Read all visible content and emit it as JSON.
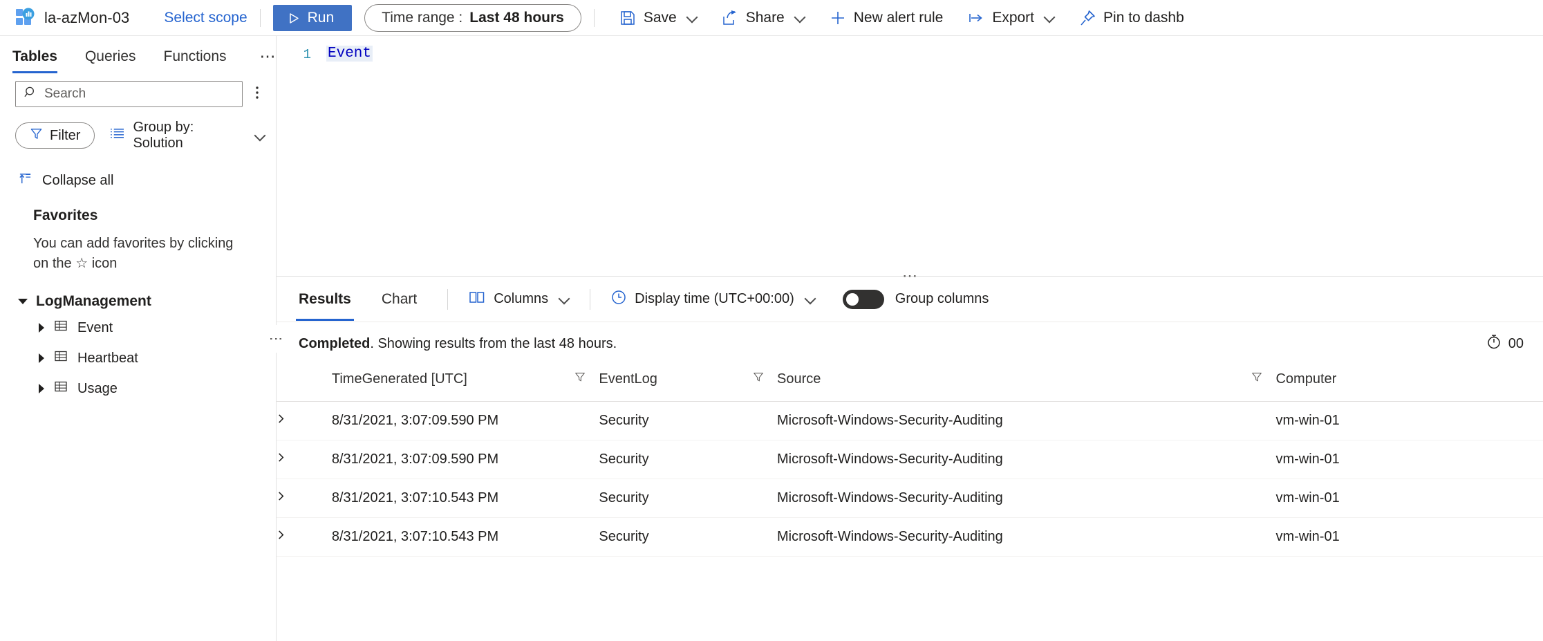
{
  "workspace": {
    "name": "la-azMon-03",
    "select_scope_label": "Select scope",
    "logo_icon": "log-analytics-workspace-icon"
  },
  "toolbar": {
    "run_label": "Run",
    "time_range_label": "Time range :",
    "time_range_value": "Last 48 hours",
    "save_label": "Save",
    "share_label": "Share",
    "new_alert_rule_label": "New alert rule",
    "export_label": "Export",
    "pin_label": "Pin to dashb",
    "icons": {
      "run": "play-icon",
      "save": "save-icon",
      "share": "share-icon",
      "new_alert": "plus-icon",
      "export": "export-icon",
      "pin": "pin-icon",
      "dropdown": "chevron-down-icon"
    }
  },
  "sidebar": {
    "tabs": [
      {
        "label": "Tables",
        "active": true
      },
      {
        "label": "Queries",
        "active": false
      },
      {
        "label": "Functions",
        "active": false
      }
    ],
    "more_label": "⋯",
    "collapse_panel_label": "«",
    "search": {
      "placeholder": "Search",
      "value": "",
      "icon": "search-icon",
      "menu_icon": "vertical-dots-icon"
    },
    "filter_label": "Filter",
    "filter_icon": "funnel-icon",
    "group_by_label": "Group by: Solution",
    "group_by_icon": "group-list-icon",
    "collapse_all_label": "Collapse all",
    "collapse_all_icon": "collapse-all-icon",
    "favorites": {
      "heading": "Favorites",
      "empty_text_1": "You can add favorites by clicking on",
      "empty_text_2_pre": "the",
      "empty_text_star": "☆",
      "empty_text_2_post": "icon"
    },
    "tree": [
      {
        "group": "LogManagement",
        "expanded": true,
        "items": [
          {
            "label": "Event",
            "icon": "table-icon"
          },
          {
            "label": "Heartbeat",
            "icon": "table-icon"
          },
          {
            "label": "Usage",
            "icon": "table-icon"
          }
        ]
      }
    ]
  },
  "editor": {
    "line_number": "1",
    "query_text": "Event"
  },
  "results": {
    "tabs": [
      {
        "label": "Results",
        "active": true
      },
      {
        "label": "Chart",
        "active": false
      }
    ],
    "columns_label": "Columns",
    "columns_icon": "columns-icon",
    "display_time_label": "Display time (UTC+00:00)",
    "display_time_icon": "clock-icon",
    "group_columns_label": "Group columns",
    "group_columns_on": false,
    "status_bold": "Completed",
    "status_rest": ". Showing results from the last 48 hours.",
    "elapsed_icon": "timer-icon",
    "elapsed_value": "00",
    "table": {
      "headers": [
        {
          "label": "TimeGenerated [UTC]",
          "filterable": true
        },
        {
          "label": "EventLog",
          "filterable": true
        },
        {
          "label": "Source",
          "filterable": true
        },
        {
          "label": "Computer",
          "filterable": false
        }
      ],
      "rows": [
        {
          "TimeGenerated": "8/31/2021, 3:07:09.590 PM",
          "EventLog": "Security",
          "Source": "Microsoft-Windows-Security-Auditing",
          "Computer": "vm-win-01"
        },
        {
          "TimeGenerated": "8/31/2021, 3:07:09.590 PM",
          "EventLog": "Security",
          "Source": "Microsoft-Windows-Security-Auditing",
          "Computer": "vm-win-01"
        },
        {
          "TimeGenerated": "8/31/2021, 3:07:10.543 PM",
          "EventLog": "Security",
          "Source": "Microsoft-Windows-Security-Auditing",
          "Computer": "vm-win-01"
        },
        {
          "TimeGenerated": "8/31/2021, 3:07:10.543 PM",
          "EventLog": "Security",
          "Source": "Microsoft-Windows-Security-Auditing",
          "Computer": "vm-win-01"
        }
      ],
      "expand_icon": "chevron-right-icon"
    }
  },
  "colors": {
    "accent": "#2564cf",
    "run_button": "#4072c4",
    "link": "#2564cf",
    "text": "#201f1e",
    "keyword": "#0000c0"
  }
}
